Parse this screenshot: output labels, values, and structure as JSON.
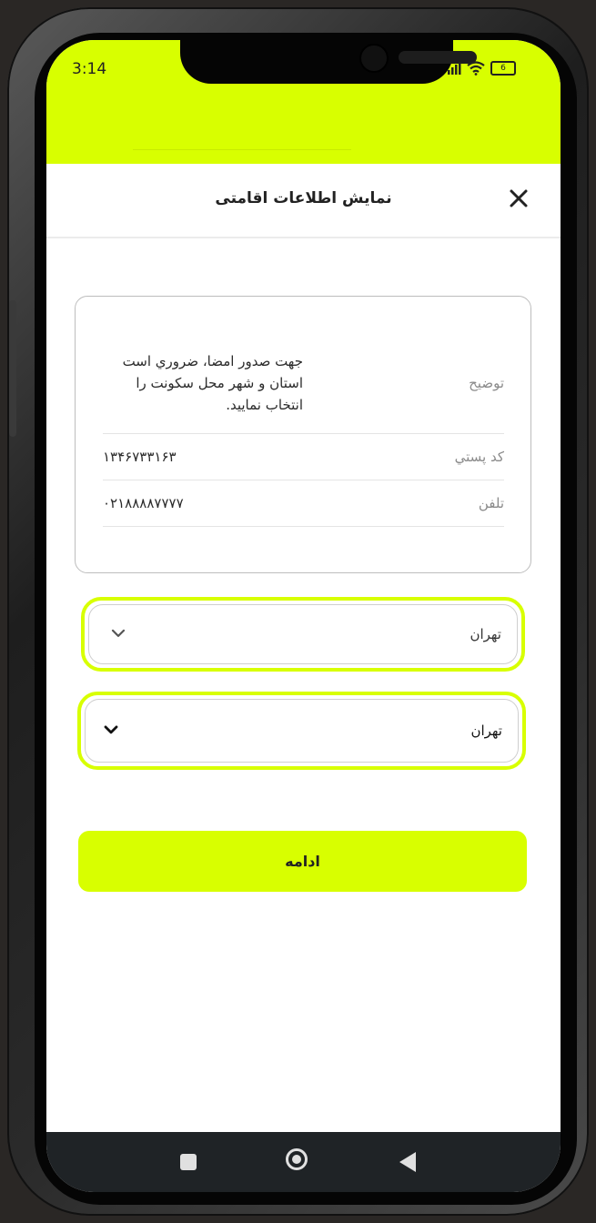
{
  "status_bar": {
    "time": "3:14",
    "battery": "6"
  },
  "sheet": {
    "title": "نمایش اطلاعات اقامتی",
    "close_icon": "close-icon"
  },
  "info_card": {
    "rows": [
      {
        "label": "توضیح",
        "value_lines": [
          "جهت صدور امضا، ضروري است",
          "استان و شهر محل سکونت را",
          "انتخاب نمایید."
        ]
      },
      {
        "label": "کد پستي",
        "value": "۱۳۴۶۷۳۳۱۶۳"
      },
      {
        "label": "تلفن",
        "value": "۰۲۱۸۸۸۸۷۷۷۷"
      }
    ]
  },
  "selects": [
    {
      "value": "تهران",
      "icon": "chevron-down-icon"
    },
    {
      "value": "تهران",
      "icon": "chevron-down-icon"
    }
  ],
  "continue_button": {
    "label": "ادامه"
  },
  "colors": {
    "accent": "#d8ff00",
    "nav_bar": "#1f2326"
  },
  "nav_bar": {
    "icons": [
      "recent-apps-icon",
      "home-icon",
      "back-icon"
    ]
  }
}
